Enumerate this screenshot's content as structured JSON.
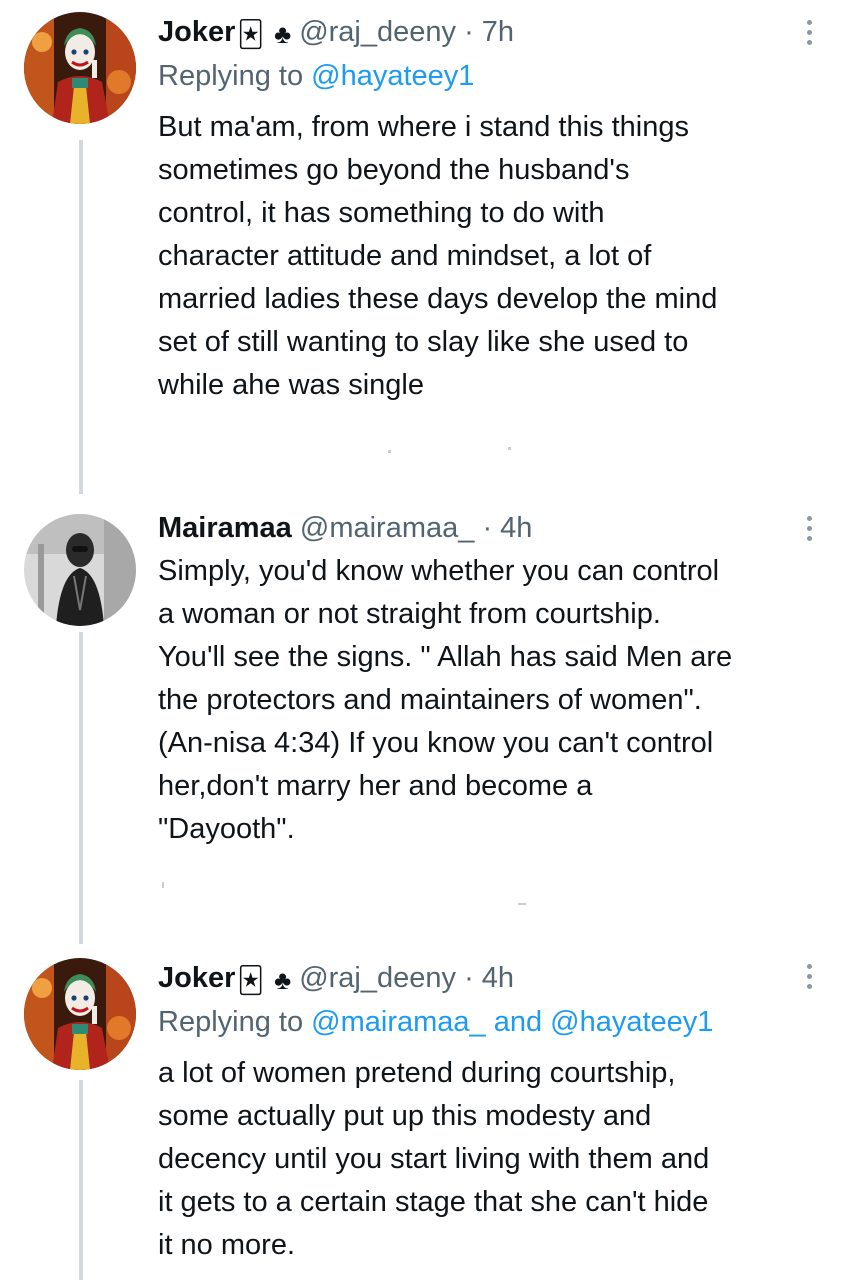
{
  "tweets": [
    {
      "name": "Joker",
      "emoji_1": "🃏",
      "emoji_2": "♣",
      "handle": "@raj_deeny",
      "separator": "·",
      "time": "7h",
      "replying_prefix": "Replying to",
      "replying_to": "@hayateey1",
      "replying_and": "",
      "replying_to_2": "",
      "text": "But ma'am, from where i stand this things\nsometimes go beyond the husband's\ncontrol, it has something to do with\ncharacter attitude and mindset, a lot of\nmarried ladies these days develop the mind\nset of still wanting to slay like she used to\nwhile ahe was single",
      "avatar_icon": "joker-avatar"
    },
    {
      "name": "Mairamaa",
      "emoji_1": "",
      "emoji_2": "",
      "handle": "@mairamaa_",
      "separator": "·",
      "time": "4h",
      "replying_prefix": "",
      "replying_to": "",
      "replying_and": "",
      "replying_to_2": "",
      "text": "Simply, you'd know whether you can control\na woman or not straight from courtship.\nYou'll see the signs. \" Allah has said Men are\nthe protectors and maintainers of women\".\n(An-nisa 4:34) If you know you can't control\nher,don't marry her and become a\n\"Dayooth\".",
      "avatar_icon": "mairamaa-avatar"
    },
    {
      "name": "Joker",
      "emoji_1": "🃏",
      "emoji_2": "♣",
      "handle": "@raj_deeny",
      "separator": "·",
      "time": "4h",
      "replying_prefix": "Replying to",
      "replying_to": "@mairamaa_",
      "replying_and": "and",
      "replying_to_2": "@hayateey1",
      "text": "a lot of women pretend during courtship,\nsome actually put up this modesty and\ndecency until you start living with them and\nit gets to a certain stage that she can't hide\nit no more.",
      "avatar_icon": "joker-avatar"
    }
  ],
  "colors": {
    "text": "#0f1419",
    "secondary": "#536471",
    "link": "#1d9bf0",
    "thread_line": "#cfd9de"
  }
}
